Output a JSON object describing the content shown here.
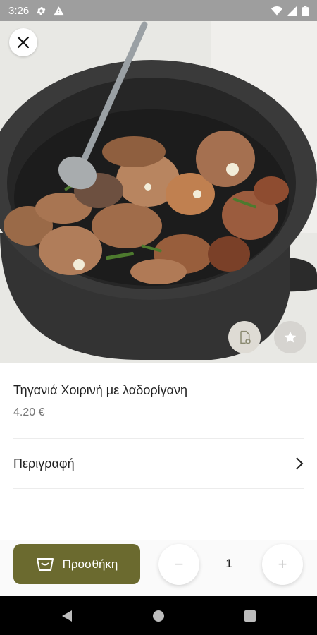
{
  "status_bar": {
    "time": "3:26"
  },
  "dish": {
    "title": "Τηγανιά Χοιρινή με λαδορίγανη",
    "price": "4.20 €"
  },
  "description_label": "Περιγραφή",
  "actions": {
    "add_label": "Προσθήκη",
    "quantity": "1",
    "minus": "−",
    "plus": "+"
  },
  "icons": {
    "close": "close-icon",
    "note": "note-add-icon",
    "favorite": "star-icon",
    "description_arrow": "chevron-right-icon",
    "cart": "basket-icon"
  },
  "colors": {
    "accent": "#6b6a2f",
    "status_bar": "#9e9e9e",
    "nav_bar": "#000000"
  }
}
